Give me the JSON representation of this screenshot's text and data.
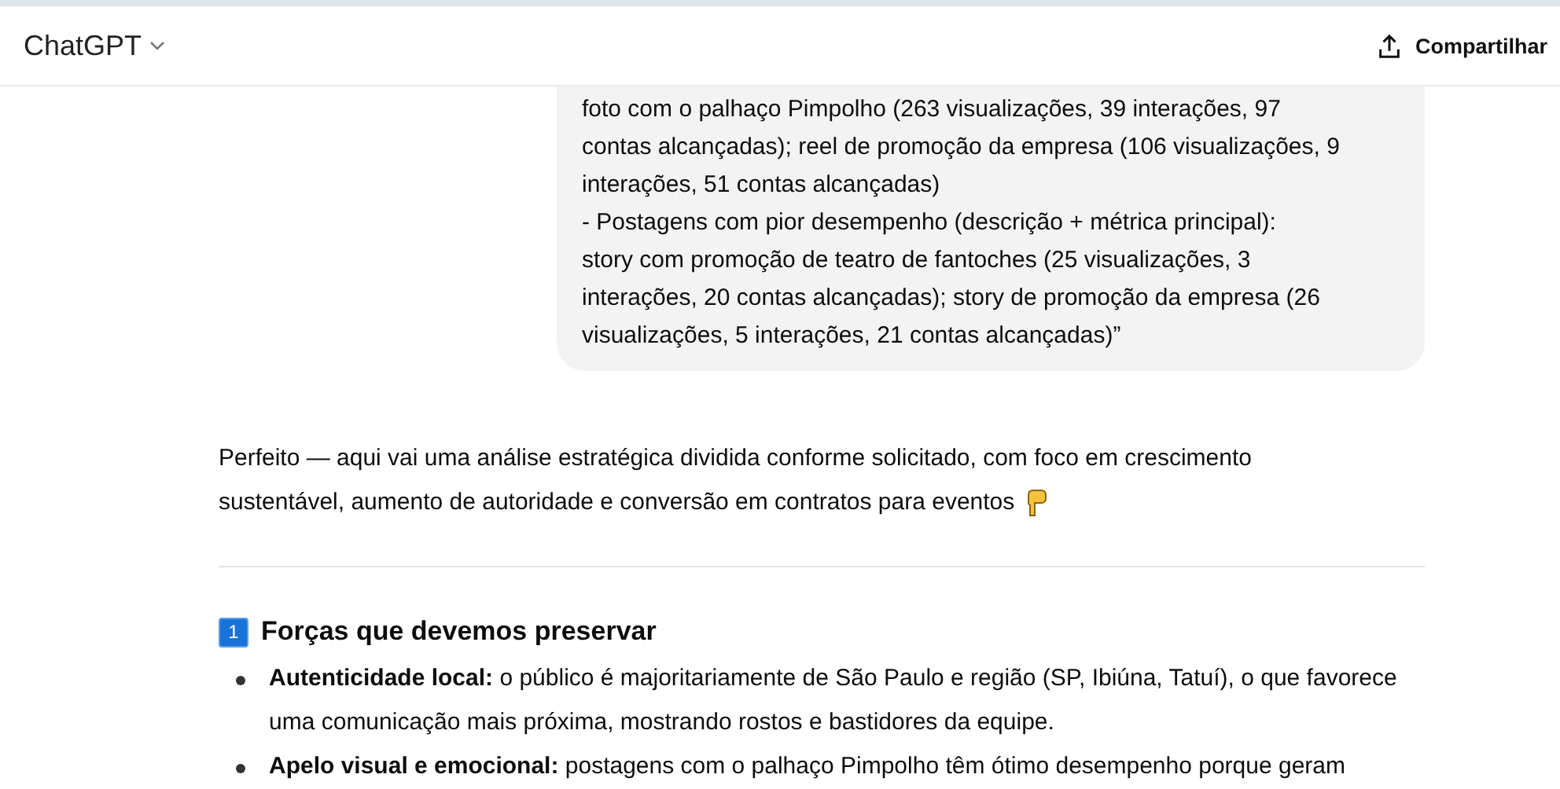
{
  "header": {
    "title": "ChatGPT",
    "share_button": "Compartilhar"
  },
  "user_message": {
    "lines": [
      "foto com o palhaço Pimpolho (263 visualizações, 39 interações, 97",
      "contas alcançadas); reel de promoção da empresa (106 visualizações, 9",
      "interações, 51 contas alcançadas)",
      "- Postagens com pior desempenho (descrição + métrica principal):",
      "story com promoção de teatro de fantoches (25 visualizações, 3",
      "interações, 20 contas alcançadas); story de promoção da empresa (26",
      "visualizações, 5 interações, 21 contas alcançadas)”"
    ]
  },
  "assistant_message": {
    "intro_lines": [
      "Perfeito — aqui vai uma análise estratégica dividida conforme solicitado, com foco em crescimento",
      "sustentável, aumento de autoridade e conversão em contratos para eventos"
    ],
    "section": {
      "number": "1",
      "title": "Forças que devemos preservar",
      "bullets": [
        {
          "text": "**Autenticidade local:** o público é majoritariamente de São Paulo e região (SP, Ibiúna, Tatuí), o que favorece uma comunicação mais próxima, mostrando rostos e bastidores da equipe."
        },
        {
          "text": "**Apelo visual e emocional:** postagens com o palhaço Pimpolho têm ótimo desempenho porque geram"
        }
      ]
    }
  }
}
